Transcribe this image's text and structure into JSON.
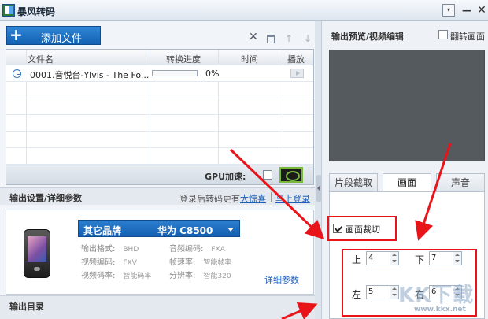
{
  "window": {
    "title": "暴风转码",
    "menu_glyph": "▾",
    "minimize_glyph": "—",
    "close_glyph": "✕"
  },
  "toolbar": {
    "add_file_plus": "+",
    "add_file_label": "添加文件",
    "delete_glyph": "✕",
    "up_glyph": "↑",
    "down_glyph": "↓"
  },
  "file_table": {
    "columns": [
      "文件名",
      "转换进度",
      "时间",
      "播放"
    ],
    "rows": [
      {
        "name": "0001.音悦台-Ylvis - The Fo...",
        "progress_percent": 0,
        "progress_label": "0%",
        "time": ""
      }
    ]
  },
  "gpu": {
    "label": "GPU加速:"
  },
  "output_settings": {
    "title": "输出设置/详细参数",
    "login_hint": "登录后转码更有",
    "surprise_link": "大惊喜",
    "login_link": "马上登录",
    "device_brand": "其它品牌",
    "device_model": "华为  C8500",
    "params": [
      {
        "key": "输出格式:",
        "value": "BHD"
      },
      {
        "key": "音频编码:",
        "value": "FXA"
      },
      {
        "key": "视频编码:",
        "value": "FXV"
      },
      {
        "key": "帧速率:",
        "value": "智能帧率"
      },
      {
        "key": "视频码率:",
        "value": "智能码率"
      },
      {
        "key": "分辨率:",
        "value": "智能320"
      }
    ],
    "detail_link": "详细参数"
  },
  "output_dir": {
    "title": "输出目录"
  },
  "preview": {
    "title": "输出预览/视频编辑",
    "flip_label": "翻转画面"
  },
  "edit_tabs": [
    "片段截取",
    "画面",
    "声音"
  ],
  "crop": {
    "label": "画面裁切",
    "top_label": "上",
    "top_value": "4",
    "bottom_label": "下",
    "bottom_value": "7",
    "left_label": "左",
    "left_value": "5",
    "right_label": "右",
    "right_value": "6"
  },
  "watermark": {
    "logo": "KK下载",
    "url": "www.kkx.net"
  },
  "colors": {
    "accent_blue": "#1a6fc4",
    "highlight_red": "#e8141a",
    "preview_bg": "#555a5f"
  }
}
